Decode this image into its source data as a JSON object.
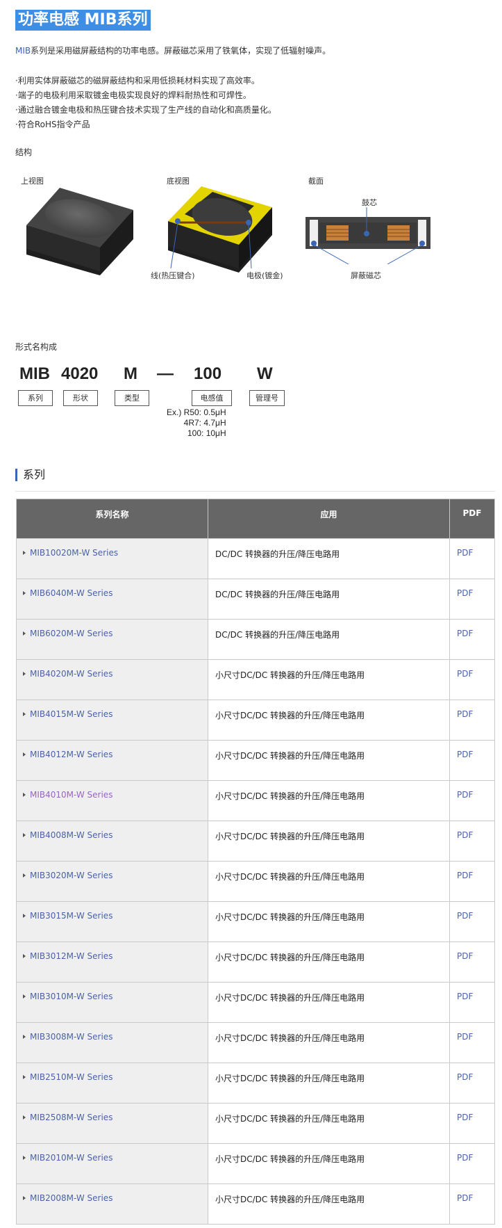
{
  "title": "功率电感 MIB系列",
  "intro": {
    "brand": "MIB",
    "text": "系列是采用磁屏蔽结构的功率电感。屏蔽磁芯采用了铁氧体，实现了低辐射噪声。"
  },
  "features": [
    "·利用实体屏蔽磁芯的磁屏蔽结构和采用低损耗材料实现了高效率。",
    "·端子的电极利用采取镀金电极实现良好的焊料耐热性和可焊性。",
    "·通过融合镀金电极和热压键合技术实现了生产线的自动化和高质量化。",
    "·符合RoHS指令产品"
  ],
  "structure": {
    "label": "结构",
    "top_view": "上视图",
    "bottom_view": "底视图",
    "section_view": "截面",
    "wire_label": "线(热压键合)",
    "electrode_label": "电极(镀金)",
    "drum_core_label": "鼓芯",
    "shield_core_label": "屏蔽磁芯"
  },
  "part_number": {
    "label": "形式名构成",
    "codes": [
      "MIB",
      "4020",
      "M",
      "—",
      "100",
      "W"
    ],
    "boxes": [
      "系列",
      "形状",
      "类型",
      "电感值",
      "管理号"
    ],
    "examples": [
      "Ex.) R50: 0.5μH",
      "4R7: 4.7μH",
      "100: 10μH"
    ]
  },
  "series_heading": "系列",
  "table": {
    "headers": [
      "系列名称",
      "应用",
      "PDF"
    ],
    "rows": [
      {
        "name": "MIB10020M-W Series",
        "app": "DC/DC 转换器的升压/降压电路用",
        "pdf": "PDF"
      },
      {
        "name": "MIB6040M-W Series",
        "app": "DC/DC 转换器的升压/降压电路用",
        "pdf": "PDF"
      },
      {
        "name": "MIB6020M-W Series",
        "app": "DC/DC 转换器的升压/降压电路用",
        "pdf": "PDF"
      },
      {
        "name": "MIB4020M-W Series",
        "app": "小尺寸DC/DC 转换器的升压/降压电路用",
        "pdf": "PDF"
      },
      {
        "name": "MIB4015M-W Series",
        "app": "小尺寸DC/DC 转换器的升压/降压电路用",
        "pdf": "PDF"
      },
      {
        "name": "MIB4012M-W Series",
        "app": "小尺寸DC/DC 转换器的升压/降压电路用",
        "pdf": "PDF"
      },
      {
        "name": "MIB4010M-W Series",
        "app": "小尺寸DC/DC 转换器的升压/降压电路用",
        "pdf": "PDF"
      },
      {
        "name": "MIB4008M-W Series",
        "app": "小尺寸DC/DC 转换器的升压/降压电路用",
        "pdf": "PDF"
      },
      {
        "name": "MIB3020M-W Series",
        "app": "小尺寸DC/DC 转换器的升压/降压电路用",
        "pdf": "PDF"
      },
      {
        "name": "MIB3015M-W Series",
        "app": "小尺寸DC/DC 转换器的升压/降压电路用",
        "pdf": "PDF"
      },
      {
        "name": "MIB3012M-W Series",
        "app": "小尺寸DC/DC 转换器的升压/降压电路用",
        "pdf": "PDF"
      },
      {
        "name": "MIB3010M-W Series",
        "app": "小尺寸DC/DC 转换器的升压/降压电路用",
        "pdf": "PDF"
      },
      {
        "name": "MIB3008M-W Series",
        "app": "小尺寸DC/DC 转换器的升压/降压电路用",
        "pdf": "PDF"
      },
      {
        "name": "MIB2510M-W Series",
        "app": "小尺寸DC/DC 转换器的升压/降压电路用",
        "pdf": "PDF"
      },
      {
        "name": "MIB2508M-W Series",
        "app": "小尺寸DC/DC 转换器的升压/降压电路用",
        "pdf": "PDF"
      },
      {
        "name": "MIB2010M-W Series",
        "app": "小尺寸DC/DC 转换器的升压/降压电路用",
        "pdf": "PDF"
      },
      {
        "name": "MIB2008M-W Series",
        "app": "小尺寸DC/DC 转换器的升压/降压电路用",
        "pdf": "PDF"
      }
    ]
  },
  "colors": {
    "title_bg": "#3f8ee6",
    "link": "#4a63a8",
    "visited_link": "#9a63c4",
    "header_bg": "#666666",
    "name_col_bg": "#efefef",
    "accent_bar": "#3a65b5"
  }
}
